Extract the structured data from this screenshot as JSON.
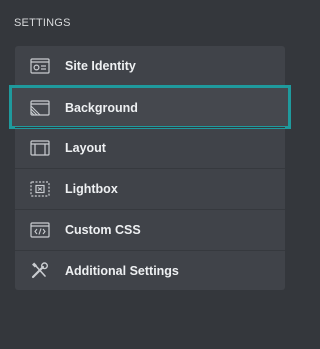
{
  "settings": {
    "title": "SETTINGS",
    "items": [
      {
        "label": "Site Identity",
        "icon": "site-identity-icon",
        "active": false
      },
      {
        "label": "Background",
        "icon": "background-icon",
        "active": true
      },
      {
        "label": "Layout",
        "icon": "layout-icon",
        "active": false
      },
      {
        "label": "Lightbox",
        "icon": "lightbox-icon",
        "active": false
      },
      {
        "label": "Custom CSS",
        "icon": "custom-css-icon",
        "active": false
      },
      {
        "label": "Additional Settings",
        "icon": "tools-icon",
        "active": false
      }
    ]
  },
  "colors": {
    "background": "#34373c",
    "panel": "#404349",
    "active_outline": "#1f9a9d",
    "text": "#eef0f2"
  }
}
